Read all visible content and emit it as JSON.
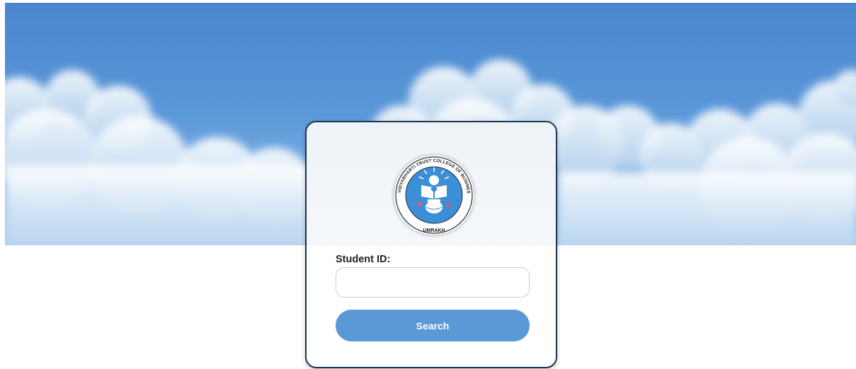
{
  "banner": {
    "sky_color": "#4a86cf",
    "cloud_color": "#e6f0fa"
  },
  "logo": {
    "arc_text": "VIDYABHARTI TRUST COLLEGE OF BUSINESS, COMPUTER SCIENCE AND RESEARCH",
    "bottom_text": "UMRAKH",
    "ring_color": "#3c8fd6"
  },
  "form": {
    "student_id_label": "Student ID:",
    "student_id_value": "",
    "student_id_placeholder": "",
    "search_label": "Search",
    "button_color": "#5a98d6"
  }
}
